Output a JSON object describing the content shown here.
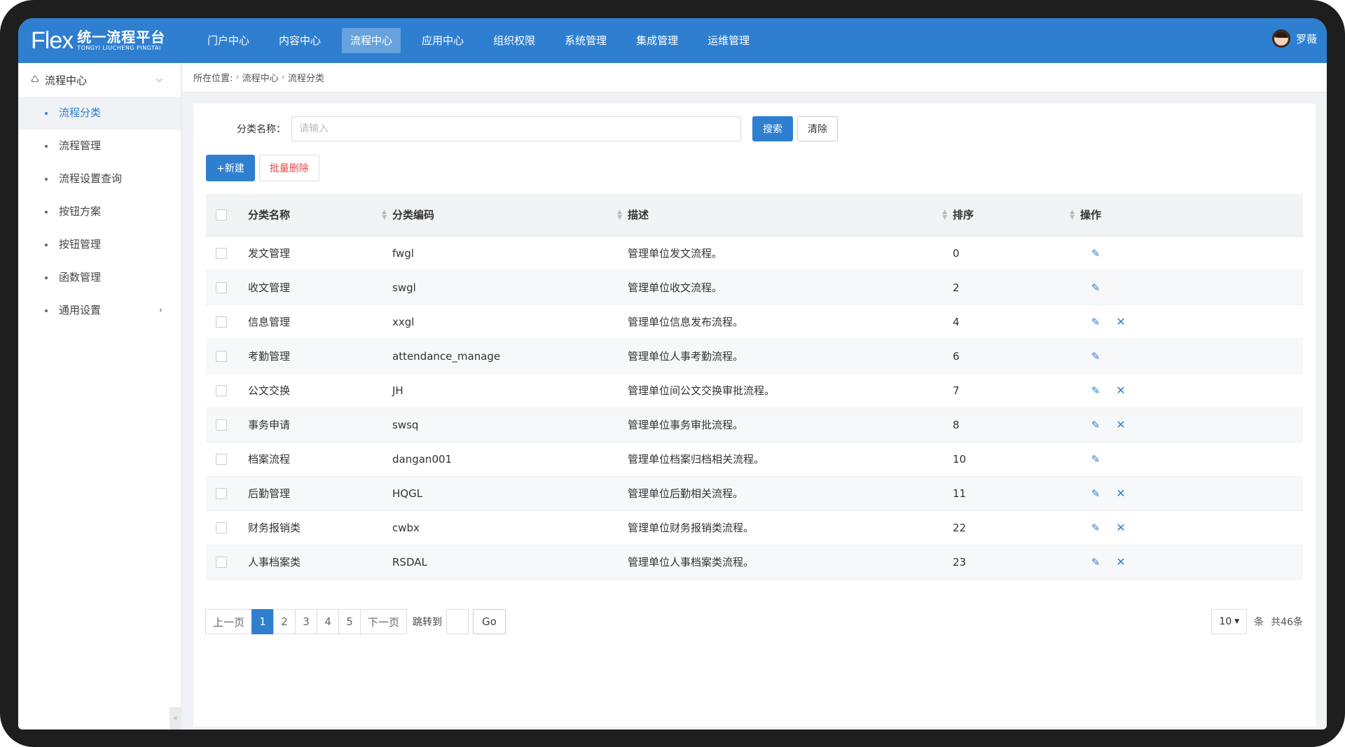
{
  "header": {
    "logo_flex": "Flex",
    "logo_cn": "统一流程平台",
    "logo_en": "TONGYI LIUCHENG PINGTAI",
    "nav": [
      "门户中心",
      "内容中心",
      "流程中心",
      "应用中心",
      "组织权限",
      "系统管理",
      "集成管理",
      "运维管理"
    ],
    "active_nav": "流程中心",
    "user_name": "罗薇"
  },
  "sidebar": {
    "title": "流程中心",
    "items": [
      {
        "label": "流程分类",
        "active": true
      },
      {
        "label": "流程管理"
      },
      {
        "label": "流程设置查询"
      },
      {
        "label": "按钮方案"
      },
      {
        "label": "按钮管理"
      },
      {
        "label": "函数管理"
      },
      {
        "label": "通用设置",
        "has_children": true
      }
    ]
  },
  "breadcrumb": {
    "prefix": "所在位置:",
    "items": [
      "流程中心",
      "流程分类"
    ]
  },
  "search": {
    "label": "分类名称：",
    "placeholder": "请输入",
    "value": "",
    "search_btn": "搜索",
    "clear_btn": "清除"
  },
  "actions": {
    "new_btn": "+新建",
    "batch_delete_btn": "批量删除"
  },
  "table": {
    "columns": [
      "分类名称",
      "分类编码",
      "描述",
      "排序",
      "操作"
    ],
    "rows": [
      {
        "name": "发文管理",
        "code": "fwgl",
        "desc": "管理单位发文流程。",
        "order": "0",
        "deletable": false
      },
      {
        "name": "收文管理",
        "code": "swgl",
        "desc": "管理单位收文流程。",
        "order": "2",
        "deletable": false
      },
      {
        "name": "信息管理",
        "code": "xxgl",
        "desc": "管理单位信息发布流程。",
        "order": "4",
        "deletable": true
      },
      {
        "name": "考勤管理",
        "code": "attendance_manage",
        "desc": "管理单位人事考勤流程。",
        "order": "6",
        "deletable": false
      },
      {
        "name": "公文交换",
        "code": "JH",
        "desc": "管理单位间公文交换审批流程。",
        "order": "7",
        "deletable": true
      },
      {
        "name": "事务申请",
        "code": "swsq",
        "desc": "管理单位事务审批流程。",
        "order": "8",
        "deletable": true
      },
      {
        "name": "档案流程",
        "code": "dangan001",
        "desc": "管理单位档案归档相关流程。",
        "order": "10",
        "deletable": false
      },
      {
        "name": "后勤管理",
        "code": "HQGL",
        "desc": "管理单位后勤相关流程。",
        "order": "11",
        "deletable": true
      },
      {
        "name": "财务报销类",
        "code": "cwbx",
        "desc": "管理单位财务报销类流程。",
        "order": "22",
        "deletable": true
      },
      {
        "name": "人事档案类",
        "code": "RSDAL",
        "desc": "管理单位人事档案类流程。",
        "order": "23",
        "deletable": true
      }
    ]
  },
  "pager": {
    "prev": "上一页",
    "pages": [
      "1",
      "2",
      "3",
      "4",
      "5"
    ],
    "current": "1",
    "next": "下一页",
    "jump_label": "跳转到",
    "go": "Go",
    "page_size": "10",
    "unit": "条",
    "total": "共46条"
  },
  "colors": {
    "primary": "#2f7fd0",
    "danger": "#e84545"
  }
}
